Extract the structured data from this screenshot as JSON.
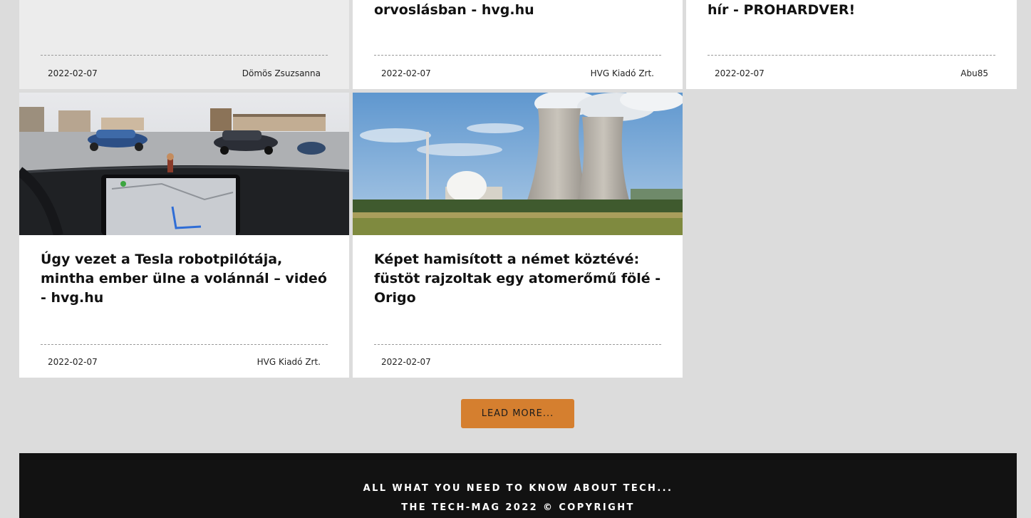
{
  "cards": [
    {
      "title": "",
      "date": "2022-02-07",
      "author": "Dömös Zsuzsanna"
    },
    {
      "title": "orvoslásban - hvg.hu",
      "date": "2022-02-07",
      "author": "HVG Kiadó Zrt."
    },
    {
      "title": "hír - PROHARDVER!",
      "date": "2022-02-07",
      "author": "Abu85"
    },
    {
      "title": "Úgy vezet a Tesla robotpilótája, mintha ember ülne a volánnál – videó - hvg.hu",
      "date": "2022-02-07",
      "author": "HVG Kiadó Zrt.",
      "image": "tesla-autopilot-dashboard-image"
    },
    {
      "title": "Képet hamisított a német köztévé: füstöt rajzoltak egy atomerőmű fölé - Origo",
      "date": "2022-02-07",
      "author": "",
      "image": "nuclear-plant-cooling-towers-image"
    }
  ],
  "load_more": {
    "label": "LEAD MORE..."
  },
  "footer": {
    "tagline": "ALL WHAT YOU NEED TO KNOW ABOUT TECH...",
    "copyright": "THE TECH-MAG 2022 © COPYRIGHT"
  },
  "colors": {
    "background": "#dcdcdc",
    "card": "#ffffff",
    "accent_button": "#d57f2f",
    "footer": "#121212"
  }
}
